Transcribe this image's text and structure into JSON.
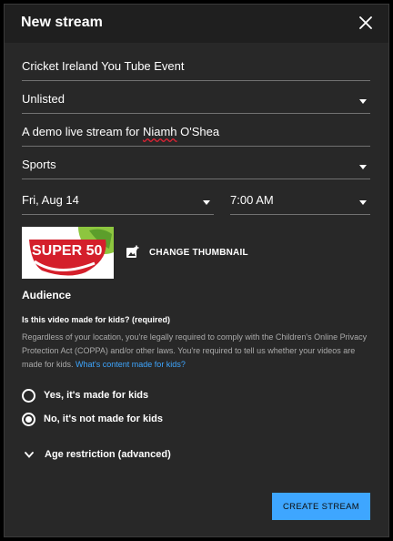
{
  "dialog": {
    "title": "New stream"
  },
  "form": {
    "title_value": "Cricket Ireland You Tube Event",
    "visibility_value": "Unlisted",
    "description_prefix": "A demo live stream for ",
    "description_flagged": "Niamh",
    "description_suffix": " O'Shea",
    "category_value": "Sports",
    "date_value": "Fri, Aug 14",
    "time_value": "7:00 AM"
  },
  "thumbnail": {
    "image_text": "SUPER 50",
    "change_label": "CHANGE THUMBNAIL"
  },
  "audience": {
    "heading": "Audience",
    "question": "Is this video made for kids? (required)",
    "description": "Regardless of your location, you're legally required to comply with the Children's Online Privacy Protection Act (COPPA) and/or other laws. You're required to tell us whether your videos are made for kids.",
    "link_text": "What's content made for kids?",
    "options": [
      {
        "label": "Yes, it's made for kids",
        "selected": false
      },
      {
        "label": "No, it's not made for kids",
        "selected": true
      }
    ],
    "age_restriction_label": "Age restriction (advanced)"
  },
  "actions": {
    "create_label": "CREATE STREAM"
  },
  "colors": {
    "accent": "#3ea6ff",
    "dialog_bg": "#282828",
    "header_bg": "#1f1f1f",
    "thumb_red": "#d41f2b",
    "thumb_green": "#8dc63f"
  }
}
